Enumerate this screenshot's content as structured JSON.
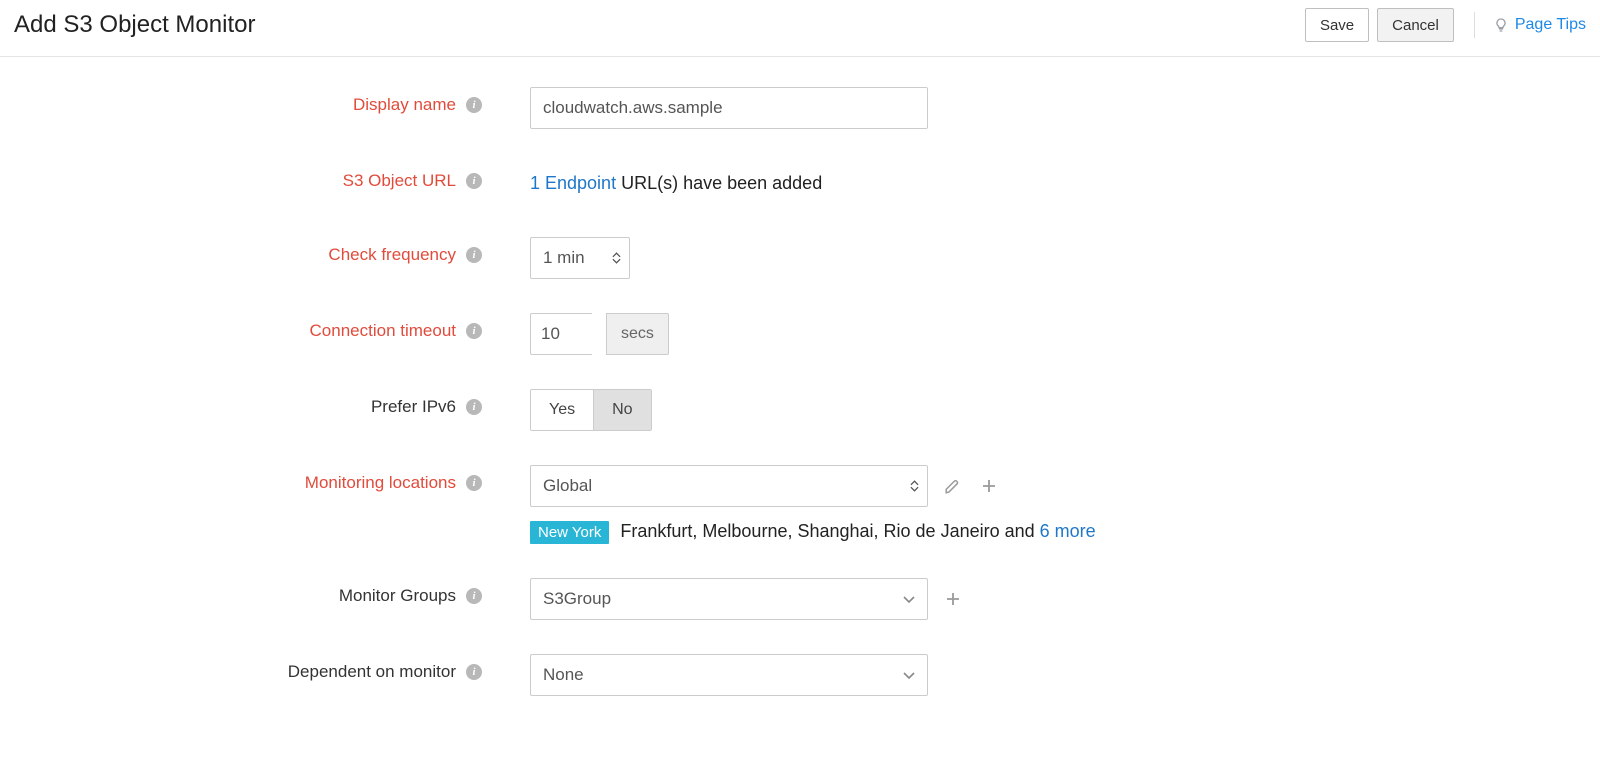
{
  "header": {
    "title": "Add S3 Object Monitor",
    "save_label": "Save",
    "cancel_label": "Cancel",
    "page_tips_label": "Page Tips"
  },
  "form": {
    "display_name": {
      "label": "Display name",
      "value": "cloudwatch.aws.sample"
    },
    "s3_url": {
      "label": "S3 Object URL",
      "link_text": "1 Endpoint",
      "suffix_text": " URL(s) have been added"
    },
    "frequency": {
      "label": "Check frequency",
      "value": "1 min"
    },
    "timeout": {
      "label": "Connection timeout",
      "value": "10",
      "unit": "secs"
    },
    "prefer_ipv6": {
      "label": "Prefer IPv6",
      "yes": "Yes",
      "no": "No",
      "selected": "No"
    },
    "locations": {
      "label": "Monitoring locations",
      "value": "Global",
      "primary_tag": "New York",
      "others_text": "Frankfurt, Melbourne, Shanghai, Rio de Janeiro and ",
      "more_text": "6 more"
    },
    "groups": {
      "label": "Monitor Groups",
      "value": "S3Group"
    },
    "dependent": {
      "label": "Dependent on monitor",
      "value": "None"
    }
  }
}
